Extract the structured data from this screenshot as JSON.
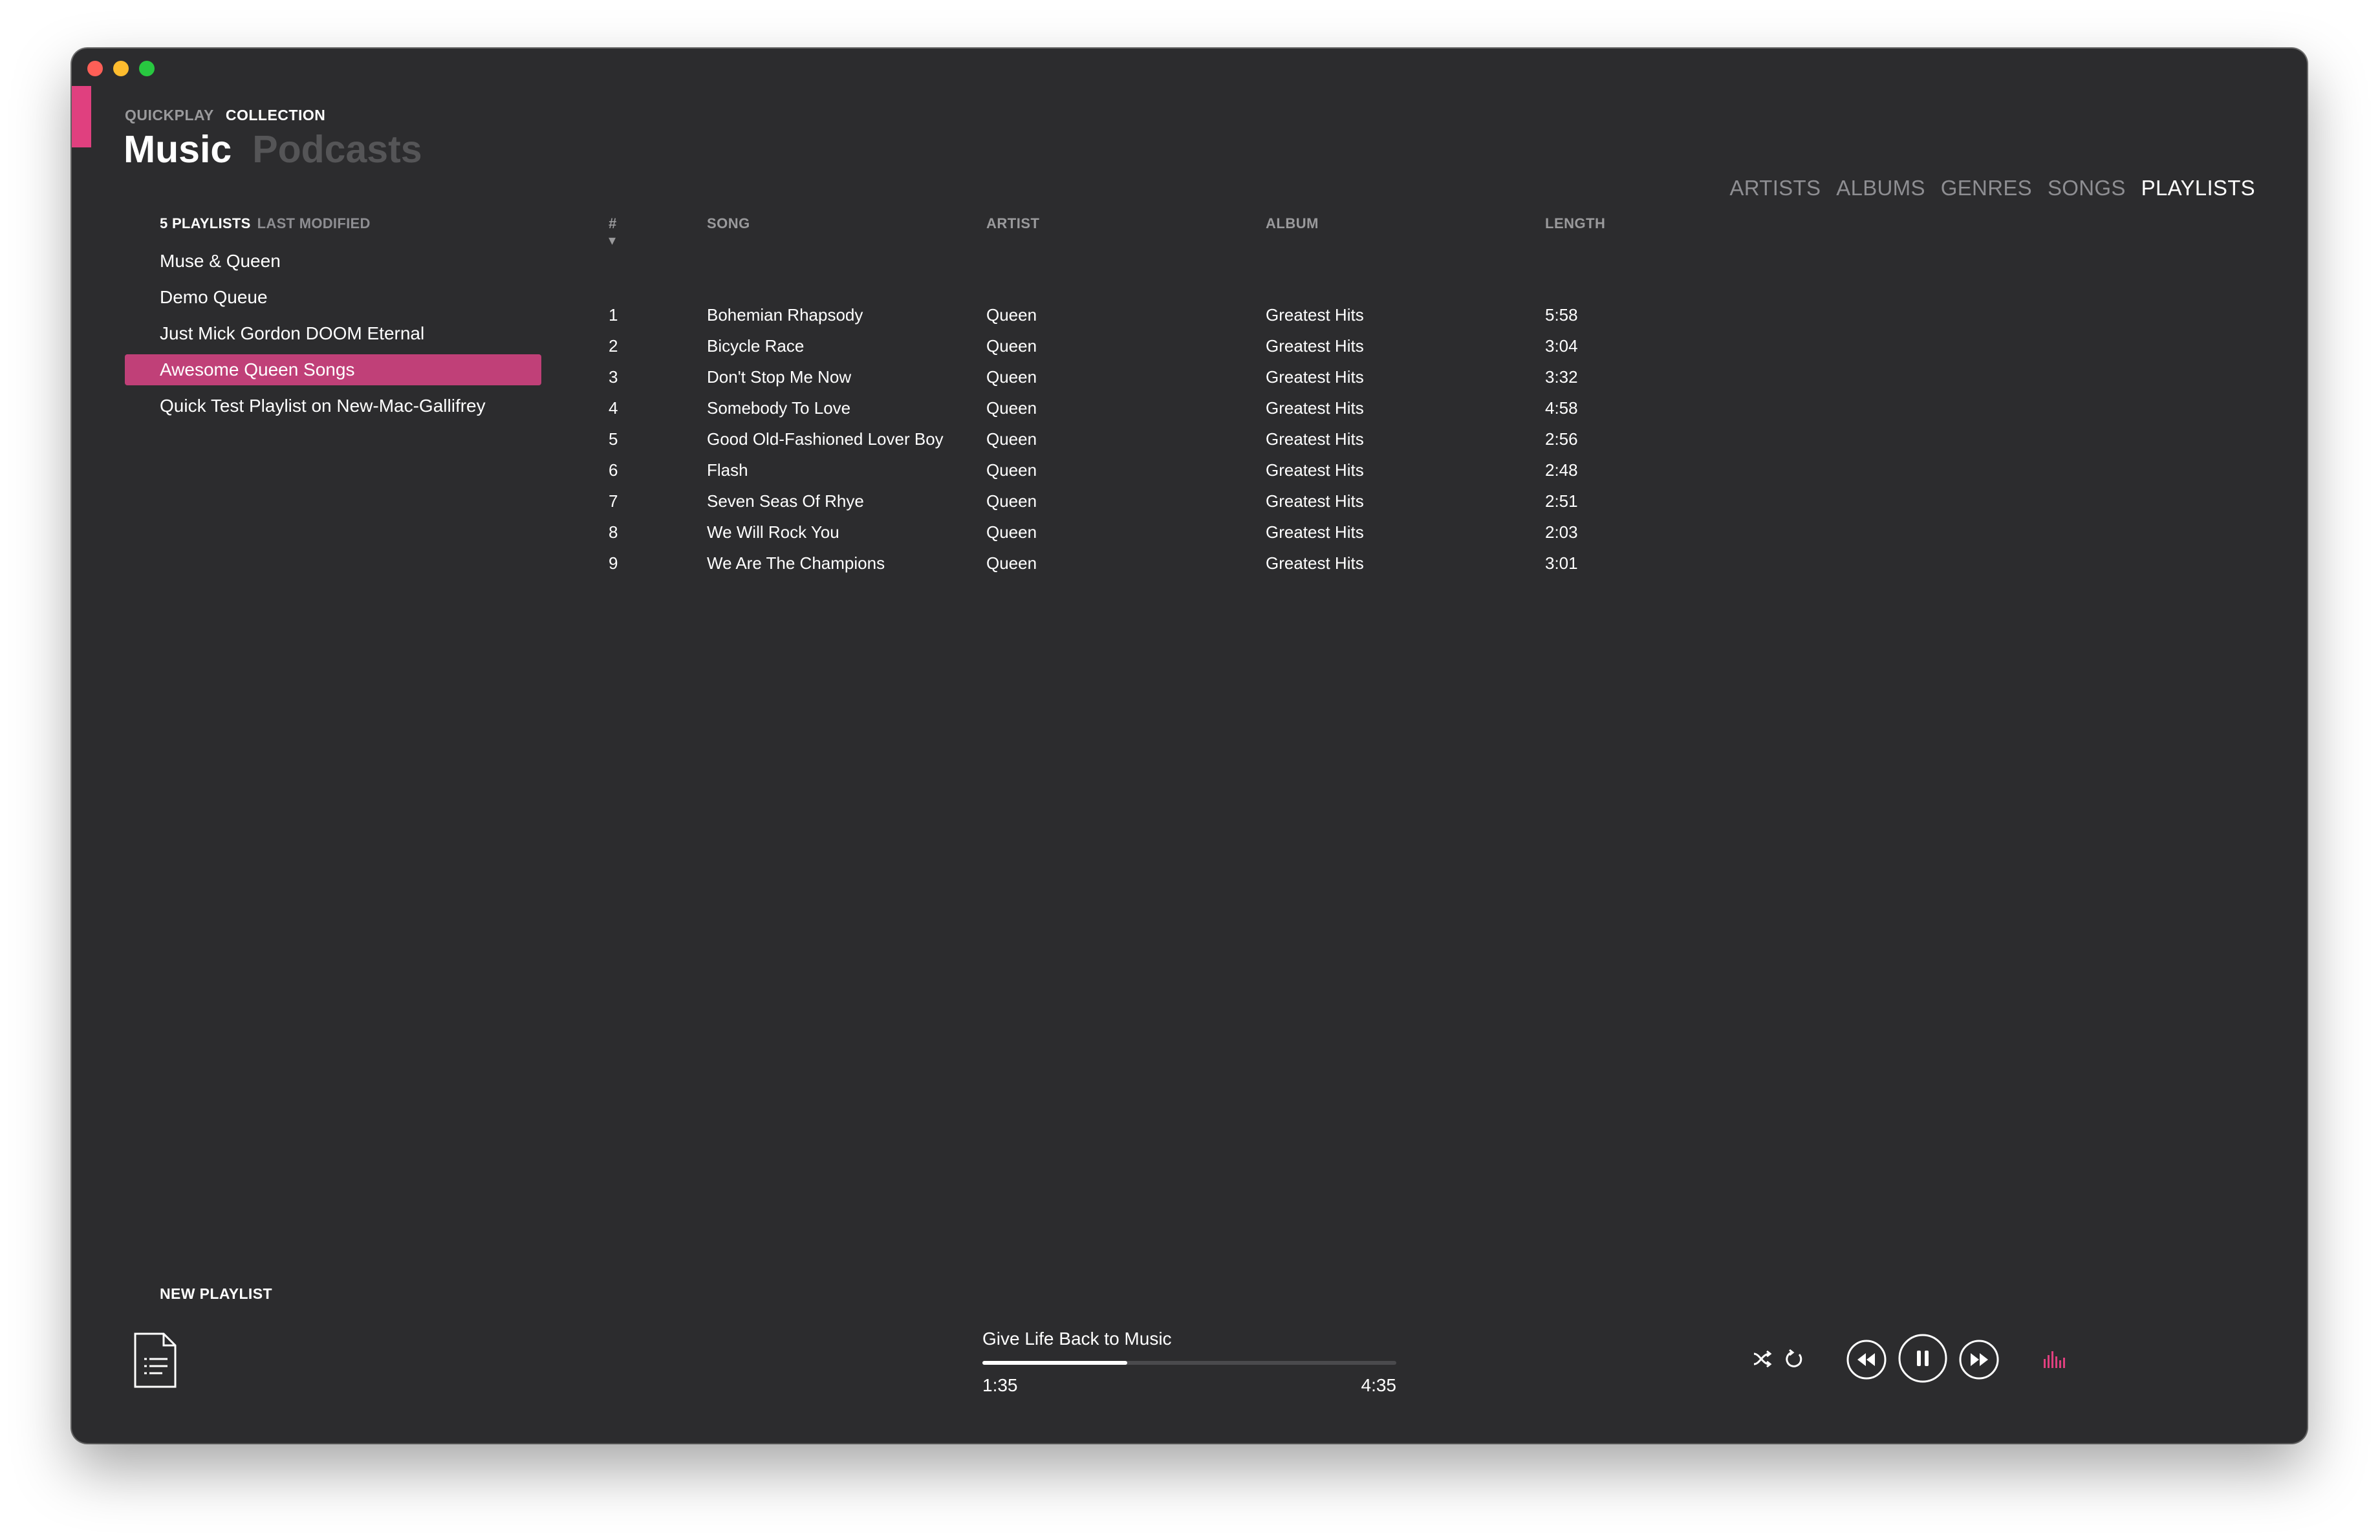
{
  "modes": {
    "quickplay": "QUICKPLAY",
    "collection": "COLLECTION"
  },
  "library": {
    "music": "Music",
    "podcasts": "Podcasts"
  },
  "view_tabs": [
    "ARTISTS",
    "ALBUMS",
    "GENRES",
    "SONGS",
    "PLAYLISTS"
  ],
  "active_view_tab": "PLAYLISTS",
  "playlists": {
    "count_label": "5 PLAYLISTS",
    "sort_label": "LAST MODIFIED",
    "items": [
      "Muse & Queen",
      "Demo Queue",
      "Just Mick Gordon DOOM Eternal",
      "Awesome Queen Songs",
      "Quick Test Playlist on New-Mac-Gallifrey"
    ],
    "selected_index": 3
  },
  "table": {
    "headers": {
      "num": "# ▾",
      "song": "SONG",
      "artist": "ARTIST",
      "album": "ALBUM",
      "length": "LENGTH"
    },
    "rows": [
      {
        "num": "1",
        "song": "Bohemian Rhapsody",
        "artist": "Queen",
        "album": "Greatest Hits",
        "length": "5:58"
      },
      {
        "num": "2",
        "song": "Bicycle Race",
        "artist": "Queen",
        "album": "Greatest Hits",
        "length": "3:04"
      },
      {
        "num": "3",
        "song": "Don't Stop Me Now",
        "artist": "Queen",
        "album": "Greatest Hits",
        "length": "3:32"
      },
      {
        "num": "4",
        "song": "Somebody To Love",
        "artist": "Queen",
        "album": "Greatest Hits",
        "length": "4:58"
      },
      {
        "num": "5",
        "song": "Good Old-Fashioned Lover Boy",
        "artist": "Queen",
        "album": "Greatest Hits",
        "length": "2:56"
      },
      {
        "num": "6",
        "song": "Flash",
        "artist": "Queen",
        "album": "Greatest Hits",
        "length": "2:48"
      },
      {
        "num": "7",
        "song": "Seven Seas Of Rhye",
        "artist": "Queen",
        "album": "Greatest Hits",
        "length": "2:51"
      },
      {
        "num": "8",
        "song": "We Will Rock You",
        "artist": "Queen",
        "album": "Greatest Hits",
        "length": "2:03"
      },
      {
        "num": "9",
        "song": "We Are The Champions",
        "artist": "Queen",
        "album": "Greatest Hits",
        "length": "3:01"
      }
    ]
  },
  "footer": {
    "new_playlist_label": "NEW PLAYLIST",
    "new_playlist_icon": "document-list-icon"
  },
  "player": {
    "track_title": "Give Life Back to Music",
    "current_time": "1:35",
    "total_time": "4:35",
    "progress_fraction": 0.35,
    "controls": [
      "shuffle-icon",
      "repeat-icon",
      "rewind-icon",
      "pause-icon",
      "fast-forward-icon",
      "equalizer-icon"
    ]
  },
  "colors": {
    "accent": "#e0407f",
    "selected_row": "#c04078",
    "window_bg": "#2c2c2e"
  }
}
